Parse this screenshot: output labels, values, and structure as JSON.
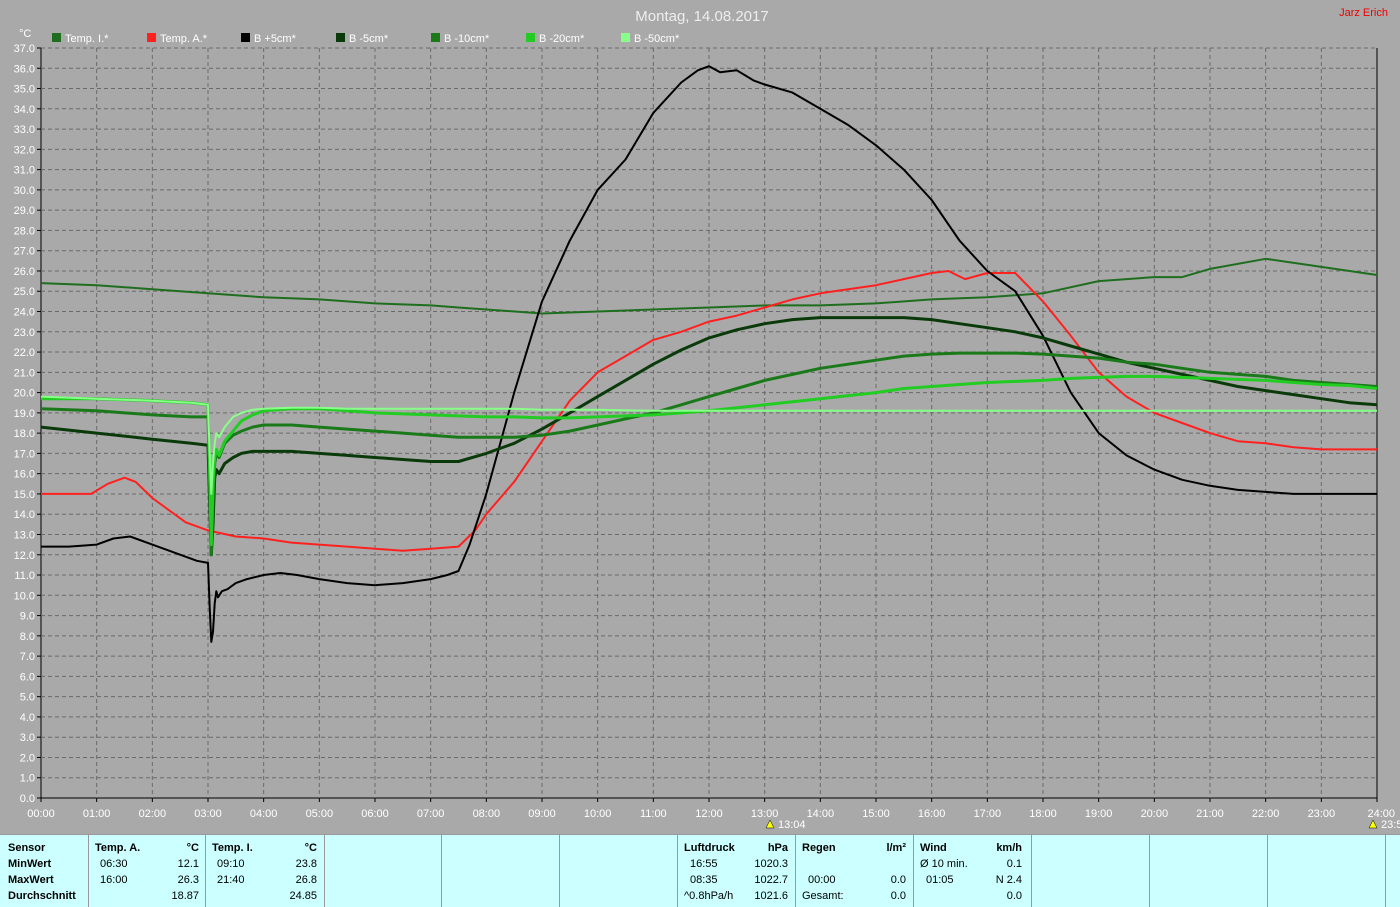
{
  "title": "Montag, 14.08.2017",
  "author": "Jarz Erich",
  "colors": {
    "temp_i": "#1f6e1f",
    "temp_a": "#ff2020",
    "b_plus5": "#000000",
    "b_minus5": "#0a3a0a",
    "b_minus10": "#1a7a1a",
    "b_minus20": "#22cc22",
    "b_minus50": "#88ff88"
  },
  "chart_data": {
    "type": "line",
    "ylabel": "°C",
    "ylim": [
      0,
      37
    ],
    "xlim": [
      0,
      24
    ],
    "yticks": [
      "0.0",
      "1.0",
      "2.0",
      "3.0",
      "4.0",
      "5.0",
      "6.0",
      "7.0",
      "8.0",
      "9.0",
      "10.0",
      "11.0",
      "12.0",
      "13.0",
      "14.0",
      "15.0",
      "16.0",
      "17.0",
      "18.0",
      "19.0",
      "20.0",
      "21.0",
      "22.0",
      "23.0",
      "24.0",
      "25.0",
      "26.0",
      "27.0",
      "28.0",
      "29.0",
      "30.0",
      "31.0",
      "32.0",
      "33.0",
      "34.0",
      "35.0",
      "36.0",
      "37.0"
    ],
    "xticks": [
      "00:00",
      "01:00",
      "02:00",
      "03:00",
      "04:00",
      "05:00",
      "06:00",
      "07:00",
      "08:00",
      "09:00",
      "10:00",
      "11:00",
      "12:00",
      "13:00",
      "14:00",
      "15:00",
      "16:00",
      "17:00",
      "18:00",
      "19:00",
      "20:00",
      "21:00",
      "22:00",
      "23:00",
      "24:00"
    ],
    "markers": [
      "13:04",
      "23:5"
    ],
    "grid": true,
    "legend": "top",
    "series": [
      {
        "name": "Temp. I.*",
        "color": "#1f6e1f",
        "width": 2,
        "x": [
          0,
          1,
          2,
          3,
          4,
          5,
          6,
          7,
          7.5,
          8,
          9,
          10,
          11,
          12,
          13,
          14,
          15,
          16,
          17,
          18,
          19,
          20,
          20.5,
          21,
          22,
          23,
          24
        ],
        "y": [
          25.4,
          25.3,
          25.1,
          24.9,
          24.7,
          24.6,
          24.4,
          24.3,
          24.2,
          24.1,
          23.9,
          24.0,
          24.1,
          24.2,
          24.3,
          24.3,
          24.4,
          24.6,
          24.7,
          24.9,
          25.5,
          25.7,
          25.7,
          26.1,
          26.6,
          26.2,
          25.8
        ]
      },
      {
        "name": "Temp. A.*",
        "color": "#ff2020",
        "width": 2,
        "x": [
          0,
          0.5,
          0.9,
          1.2,
          1.5,
          1.7,
          2,
          2.3,
          2.6,
          3,
          3.5,
          4,
          4.5,
          5,
          5.5,
          6,
          6.5,
          7,
          7.5,
          7.8,
          8,
          8.5,
          9,
          9.5,
          10,
          10.5,
          11,
          11.5,
          12,
          12.5,
          13,
          13.5,
          14,
          14.5,
          15,
          15.5,
          16,
          16.3,
          16.6,
          17,
          17.5,
          18,
          18.5,
          19,
          19.5,
          20,
          20.5,
          21,
          21.5,
          22,
          22.5,
          23,
          23.5,
          24
        ],
        "y": [
          15.0,
          15.0,
          15.0,
          15.5,
          15.8,
          15.6,
          14.8,
          14.2,
          13.6,
          13.2,
          12.9,
          12.8,
          12.6,
          12.5,
          12.4,
          12.3,
          12.2,
          12.3,
          12.4,
          13.2,
          14.0,
          15.6,
          17.6,
          19.6,
          21.0,
          21.8,
          22.6,
          23.0,
          23.5,
          23.8,
          24.2,
          24.6,
          24.9,
          25.1,
          25.3,
          25.6,
          25.9,
          26.0,
          25.6,
          25.9,
          25.9,
          24.5,
          22.8,
          21.0,
          19.8,
          19.0,
          18.5,
          18.0,
          17.6,
          17.5,
          17.3,
          17.2,
          17.2,
          17.2
        ]
      },
      {
        "name": "B +5cm*",
        "color": "#000000",
        "width": 2,
        "x": [
          0,
          0.5,
          1,
          1.3,
          1.6,
          2,
          2.4,
          2.8,
          3.0,
          3.03,
          3.06,
          3.09,
          3.12,
          3.15,
          3.18,
          3.25,
          3.35,
          3.5,
          3.7,
          4,
          4.3,
          4.6,
          5,
          5.5,
          6,
          6.5,
          7,
          7.3,
          7.5,
          7.7,
          8,
          8.5,
          9,
          9.5,
          10,
          10.5,
          11,
          11.5,
          11.8,
          12,
          12.2,
          12.5,
          12.8,
          13,
          13.5,
          14,
          14.5,
          15,
          15.5,
          16,
          16.5,
          17,
          17.5,
          18,
          18.5,
          19,
          19.5,
          20,
          20.5,
          21,
          21.5,
          22,
          22.5,
          23,
          23.5,
          24
        ],
        "y": [
          12.4,
          12.4,
          12.5,
          12.8,
          12.9,
          12.5,
          12.1,
          11.7,
          11.6,
          9.4,
          7.7,
          8.2,
          9.6,
          10.2,
          9.9,
          10.2,
          10.3,
          10.6,
          10.8,
          11.0,
          11.1,
          11.0,
          10.8,
          10.6,
          10.5,
          10.6,
          10.8,
          11.0,
          11.2,
          12.5,
          15.0,
          20.0,
          24.5,
          27.5,
          30.0,
          31.5,
          33.8,
          35.3,
          35.9,
          36.1,
          35.8,
          35.9,
          35.4,
          35.2,
          34.8,
          34.0,
          33.2,
          32.2,
          31.0,
          29.5,
          27.5,
          26.0,
          25.0,
          22.8,
          20.0,
          18.0,
          16.9,
          16.2,
          15.7,
          15.4,
          15.2,
          15.1,
          15.0,
          15.0,
          15.0,
          15.0
        ]
      },
      {
        "name": "B -5cm*",
        "color": "#0a3a0a",
        "width": 3,
        "x": [
          0,
          1,
          2,
          2.7,
          3.0,
          3.03,
          3.06,
          3.09,
          3.12,
          3.15,
          3.2,
          3.3,
          3.45,
          3.6,
          3.8,
          4,
          4.5,
          5,
          5.5,
          6,
          6.5,
          7,
          7.5,
          8,
          8.5,
          9,
          9.5,
          10,
          10.5,
          11,
          11.5,
          12,
          12.5,
          13,
          13.5,
          14,
          14.5,
          15,
          15.5,
          16,
          16.5,
          17,
          17.5,
          18,
          18.5,
          19,
          19.5,
          20,
          20.5,
          21,
          21.5,
          22,
          22.5,
          23,
          23.5,
          24
        ],
        "y": [
          18.3,
          18.0,
          17.7,
          17.5,
          17.4,
          14.5,
          12.0,
          13.5,
          15.8,
          16.2,
          16.0,
          16.5,
          16.8,
          17.0,
          17.1,
          17.1,
          17.1,
          17.0,
          16.9,
          16.8,
          16.7,
          16.6,
          16.6,
          17.0,
          17.5,
          18.2,
          19.0,
          19.8,
          20.6,
          21.4,
          22.1,
          22.7,
          23.1,
          23.4,
          23.6,
          23.7,
          23.7,
          23.7,
          23.7,
          23.6,
          23.4,
          23.2,
          23.0,
          22.7,
          22.3,
          21.9,
          21.5,
          21.2,
          20.9,
          20.6,
          20.3,
          20.1,
          19.9,
          19.7,
          19.5,
          19.4
        ]
      },
      {
        "name": "B -10cm*",
        "color": "#1a7a1a",
        "width": 3,
        "x": [
          0,
          1,
          2,
          2.7,
          3.0,
          3.03,
          3.06,
          3.09,
          3.12,
          3.15,
          3.2,
          3.3,
          3.45,
          3.6,
          3.8,
          4,
          4.5,
          5,
          5.5,
          6,
          6.5,
          7,
          7.5,
          8,
          8.5,
          9,
          9.5,
          10,
          10.5,
          11,
          11.5,
          12,
          12.5,
          13,
          13.5,
          14,
          14.5,
          15,
          15.5,
          16,
          16.5,
          17,
          17.5,
          18,
          18.5,
          19,
          19.5,
          20,
          20.5,
          21,
          21.5,
          22,
          22.5,
          23,
          23.5,
          24
        ],
        "y": [
          19.2,
          19.1,
          18.9,
          18.8,
          18.8,
          15.5,
          12.0,
          14.5,
          16.5,
          17.0,
          16.8,
          17.5,
          17.9,
          18.1,
          18.3,
          18.4,
          18.4,
          18.3,
          18.2,
          18.1,
          18.0,
          17.9,
          17.8,
          17.8,
          17.8,
          17.9,
          18.1,
          18.4,
          18.7,
          19.0,
          19.4,
          19.8,
          20.2,
          20.6,
          20.9,
          21.2,
          21.4,
          21.6,
          21.8,
          21.9,
          21.95,
          21.95,
          21.95,
          21.9,
          21.8,
          21.7,
          21.5,
          21.4,
          21.2,
          21.0,
          20.9,
          20.8,
          20.6,
          20.5,
          20.4,
          20.3
        ]
      },
      {
        "name": "B -20cm*",
        "color": "#22cc22",
        "width": 3,
        "x": [
          0,
          1,
          2,
          2.7,
          3.0,
          3.03,
          3.06,
          3.09,
          3.12,
          3.15,
          3.2,
          3.3,
          3.45,
          3.6,
          3.8,
          4,
          4.5,
          5,
          5.5,
          6,
          6.5,
          7,
          7.5,
          8,
          8.5,
          9,
          9.5,
          10,
          10.5,
          11,
          11.5,
          12,
          12.5,
          13,
          13.5,
          14,
          14.5,
          15,
          15.5,
          16,
          16.5,
          17,
          17.5,
          18,
          18.5,
          19,
          19.5,
          20,
          20.5,
          21,
          21.5,
          22,
          22.5,
          23,
          23.5,
          24
        ],
        "y": [
          19.7,
          19.7,
          19.6,
          19.5,
          19.4,
          16.0,
          12.5,
          15.5,
          16.8,
          17.2,
          16.9,
          17.6,
          18.1,
          18.6,
          18.9,
          19.1,
          19.2,
          19.2,
          19.1,
          19.0,
          18.95,
          18.9,
          18.85,
          18.8,
          18.8,
          18.75,
          18.75,
          18.8,
          18.85,
          18.9,
          19.0,
          19.1,
          19.25,
          19.4,
          19.55,
          19.7,
          19.85,
          20.0,
          20.2,
          20.3,
          20.4,
          20.5,
          20.55,
          20.6,
          20.7,
          20.75,
          20.8,
          20.8,
          20.75,
          20.7,
          20.65,
          20.6,
          20.5,
          20.4,
          20.35,
          20.2
        ]
      },
      {
        "name": "B -50cm*",
        "color": "#88ff88",
        "width": 2,
        "x": [
          0,
          1,
          2,
          2.7,
          3.0,
          3.03,
          3.06,
          3.09,
          3.12,
          3.15,
          3.2,
          3.3,
          3.45,
          3.6,
          3.8,
          4,
          4.5,
          5,
          5.5,
          6,
          6.5,
          7,
          7.5,
          8,
          8.5,
          9,
          10,
          11,
          12,
          13,
          14,
          15,
          16,
          17,
          18,
          19,
          20,
          21,
          22,
          23,
          24
        ],
        "y": [
          19.8,
          19.7,
          19.6,
          19.5,
          19.4,
          17.0,
          15.0,
          16.5,
          17.5,
          18.0,
          17.8,
          18.3,
          18.8,
          19.0,
          19.15,
          19.2,
          19.25,
          19.25,
          19.2,
          19.2,
          19.2,
          19.2,
          19.2,
          19.2,
          19.2,
          19.15,
          19.15,
          19.1,
          19.1,
          19.1,
          19.1,
          19.1,
          19.1,
          19.1,
          19.1,
          19.1,
          19.1,
          19.1,
          19.1,
          19.1,
          19.1
        ]
      }
    ]
  },
  "panel": {
    "sensor": {
      "header": "Sensor",
      "min": "MinWert",
      "max": "MaxWert",
      "avg": "Durchschnitt"
    },
    "temp_a": {
      "header": "Temp. A.",
      "unit": "°C",
      "min_time": "06:30",
      "min_val": "12.1",
      "max_time": "16:00",
      "max_val": "26.3",
      "avg": "18.87"
    },
    "temp_i": {
      "header": "Temp. I.",
      "unit": "°C",
      "min_time": "09:10",
      "min_val": "23.8",
      "max_time": "21:40",
      "max_val": "26.8",
      "avg": "24.85"
    },
    "pressure": {
      "header": "Luftdruck",
      "unit": "hPa",
      "min_time": "16:55",
      "min_val": "1020.3",
      "max_time": "08:35",
      "max_val": "1022.7",
      "trend": "^0.8hPa/h",
      "current": "1021.6"
    },
    "rain": {
      "header": "Regen",
      "unit": "l/m²",
      "time": "00:00",
      "val": "0.0",
      "total_label": "Gesamt:",
      "total": "0.0"
    },
    "wind": {
      "header": "Wind",
      "unit": "km/h",
      "avg_label": "Ø 10 min.",
      "avg_val": "0.1",
      "max_time": "01:05",
      "max_val": "N 2.4",
      "total": "0.0"
    }
  }
}
